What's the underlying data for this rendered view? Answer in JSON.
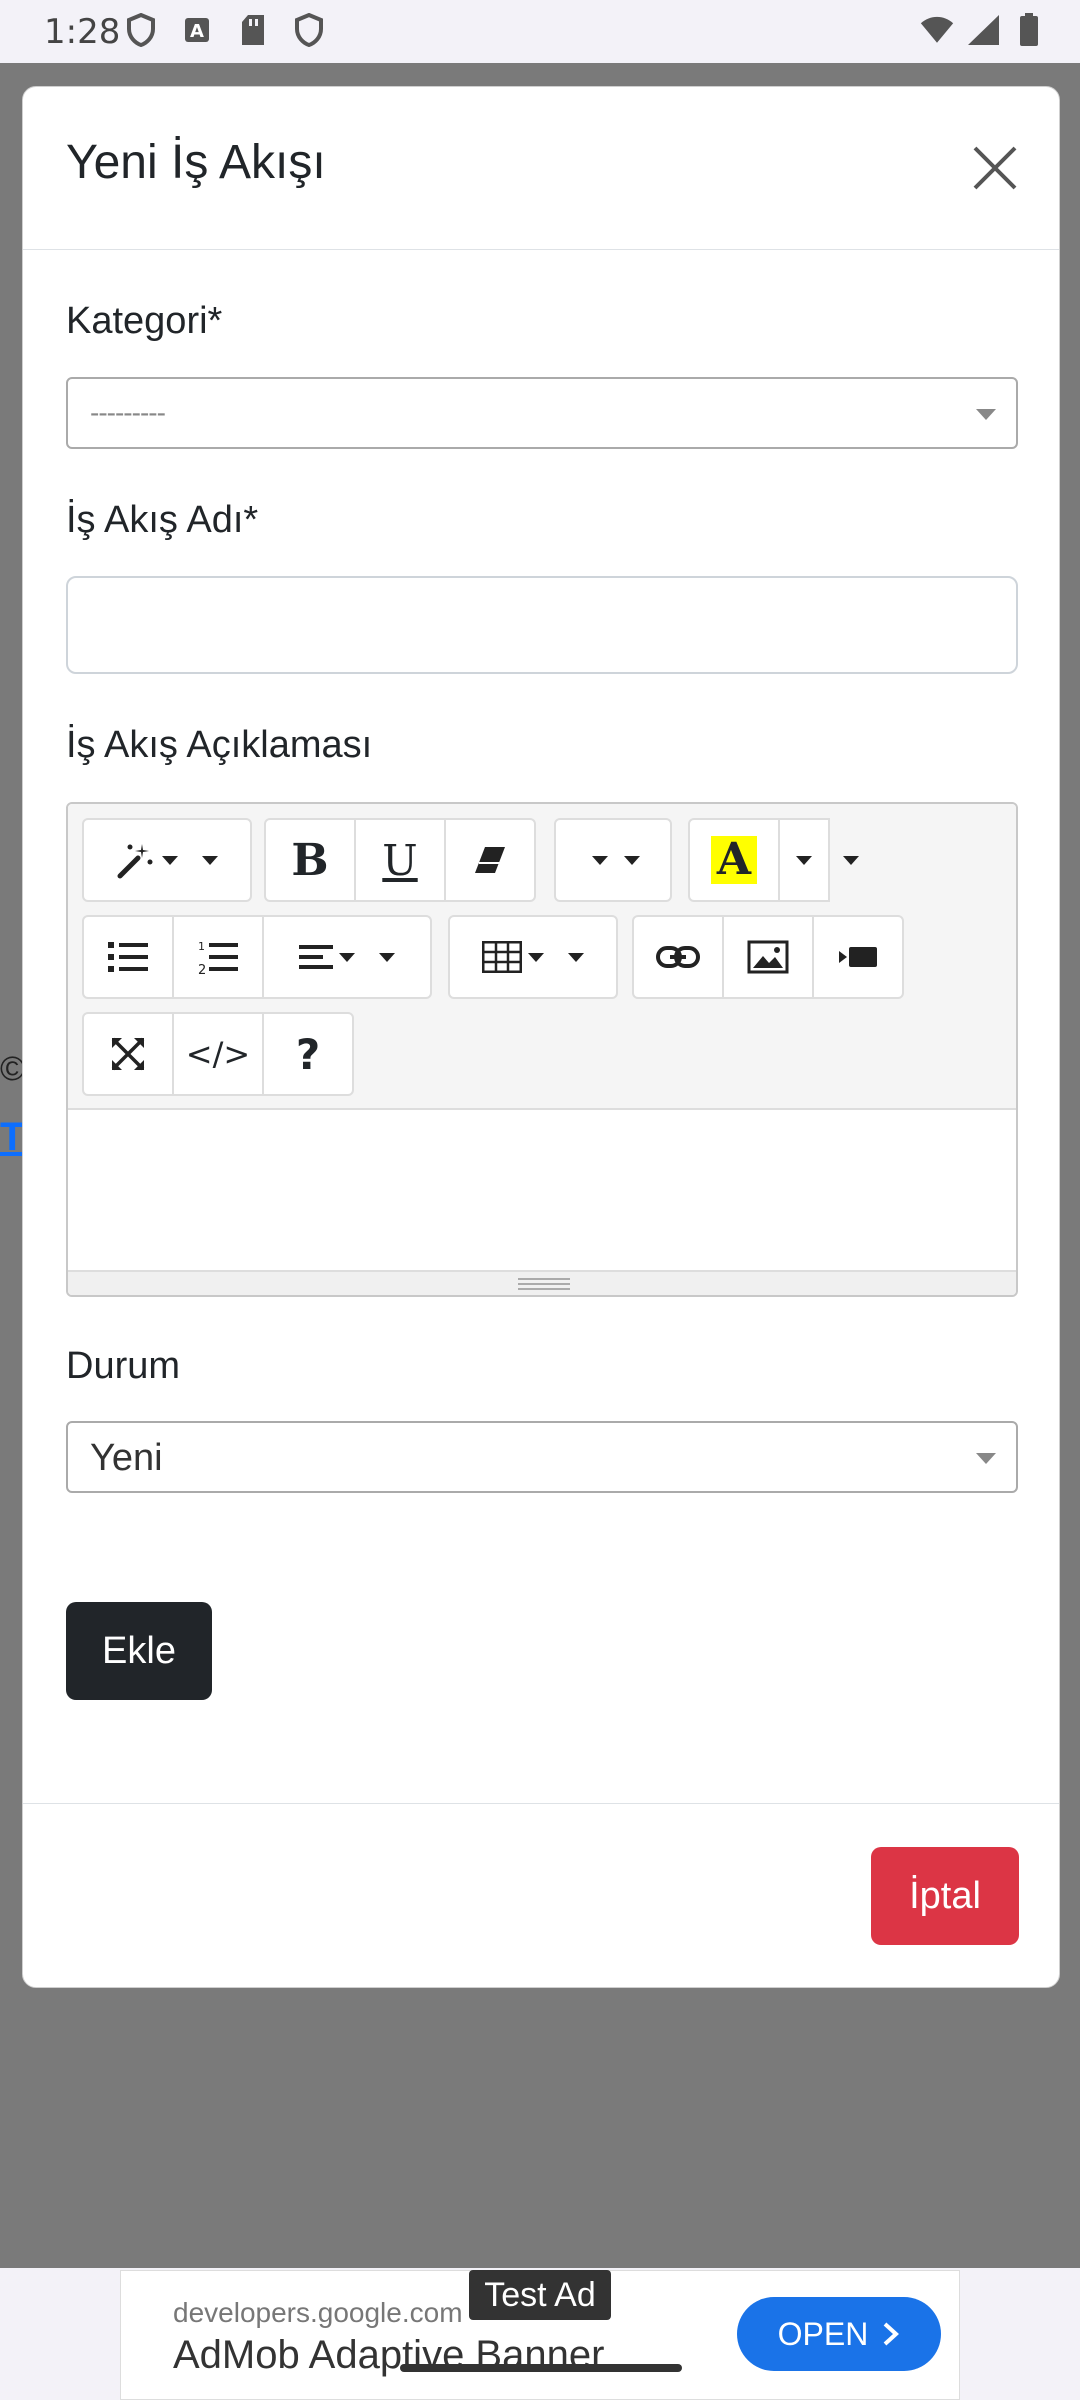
{
  "status_bar": {
    "time": "1:28",
    "left_icons": [
      "shield-icon",
      "text-a-icon",
      "sd-card-icon",
      "shield-icon"
    ],
    "right_icons": [
      "wifi-icon",
      "signal-icon",
      "battery-icon"
    ]
  },
  "background": {
    "copyright_glyph": "©",
    "link_glyph": "T"
  },
  "modal": {
    "title": "Yeni İş Akışı",
    "category_label": "Kategori*",
    "category_value": "---------",
    "name_label": "İş Akış Adı*",
    "name_value": "",
    "description_label": "İş Akış Açıklaması",
    "editor_toolbar": {
      "rows": [
        [
          "magic-wand-icon",
          "bold-icon",
          "underline-icon",
          "eraser-icon",
          "font-size-icon",
          "text-color-icon"
        ],
        [
          "unordered-list-icon",
          "ordered-list-icon",
          "align-icon",
          "table-icon",
          "link-icon",
          "picture-icon",
          "video-icon"
        ],
        [
          "fullscreen-icon",
          "code-view-icon",
          "help-icon"
        ]
      ],
      "bold_glyph": "B",
      "underline_glyph": "U",
      "color_glyph": "A",
      "code_glyph": "</>",
      "help_glyph": "?",
      "highlight_color": "#ffff00"
    },
    "status_label": "Durum",
    "status_value": "Yeni",
    "add_button": "Ekle",
    "cancel_button": "İptal"
  },
  "ad": {
    "tag": "Test Ad",
    "domain": "developers.google.com",
    "title": "AdMob Adaptive Banner",
    "open_button": "OPEN"
  },
  "colors": {
    "primary_dark": "#212529",
    "danger": "#dc3545",
    "ad_button": "#1a73e8",
    "backdrop": "#7a7a7a"
  }
}
